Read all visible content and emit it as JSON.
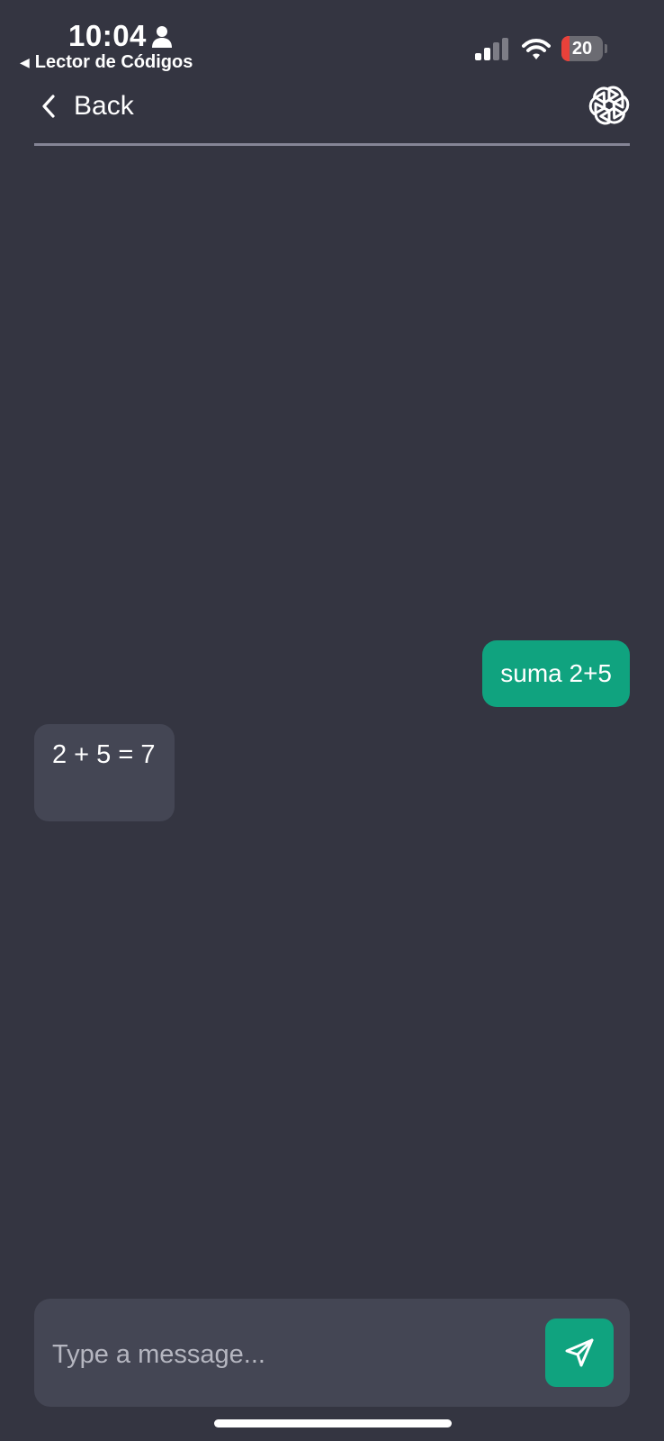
{
  "status_bar": {
    "time": "10:04",
    "back_app": "Lector de Códigos",
    "battery_level": "20",
    "battery_fraction": 0.2
  },
  "header": {
    "back_label": "Back",
    "logo_icon": "openai-logo-icon"
  },
  "messages": [
    {
      "role": "user",
      "text": "suma 2+5"
    },
    {
      "role": "assistant",
      "text": "2 + 5 = 7"
    }
  ],
  "composer": {
    "placeholder": "Type a message...",
    "value": "",
    "send_icon": "send-icon"
  },
  "colors": {
    "background": "#343541",
    "accent": "#10a37f",
    "bubble_assistant": "#444654",
    "battery_low": "#e8413a"
  }
}
